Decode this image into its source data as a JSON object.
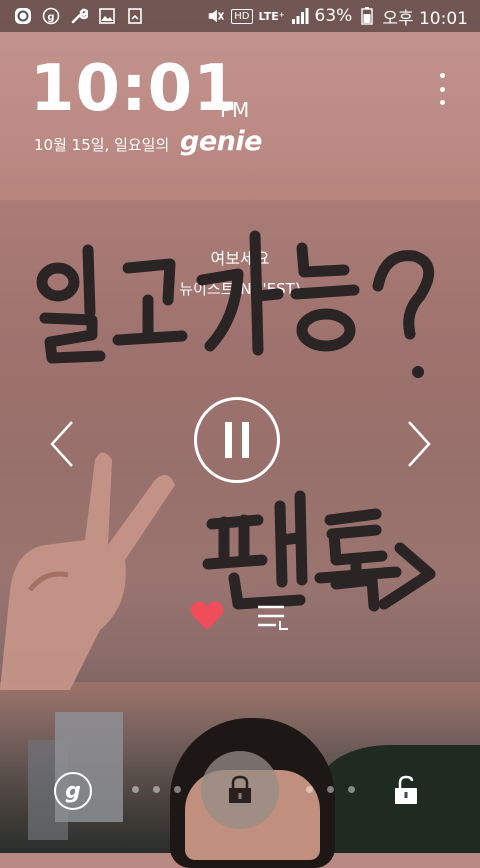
{
  "status_bar": {
    "battery": "63%",
    "time": "오후 10:01",
    "network": "LTE⁺",
    "hd": "HD",
    "icons": [
      "circle-o-icon",
      "genie-g-icon",
      "wrench-icon",
      "image-icon",
      "screenshot-icon",
      "mute-icon",
      "hd-icon",
      "lte-icon",
      "signal-icon",
      "battery-icon"
    ]
  },
  "lockscreen": {
    "clock": "10:01",
    "ampm": "PM",
    "date": "10월 15일, 일요일의",
    "app_brand": "genie"
  },
  "player": {
    "song_title": "여보세요",
    "artist": "뉴이스트(NU'EST)",
    "liked": true,
    "accent_color": "#ef4d5a"
  },
  "handwriting": {
    "line1": "일코 가능?",
    "line2": "팬톡"
  }
}
